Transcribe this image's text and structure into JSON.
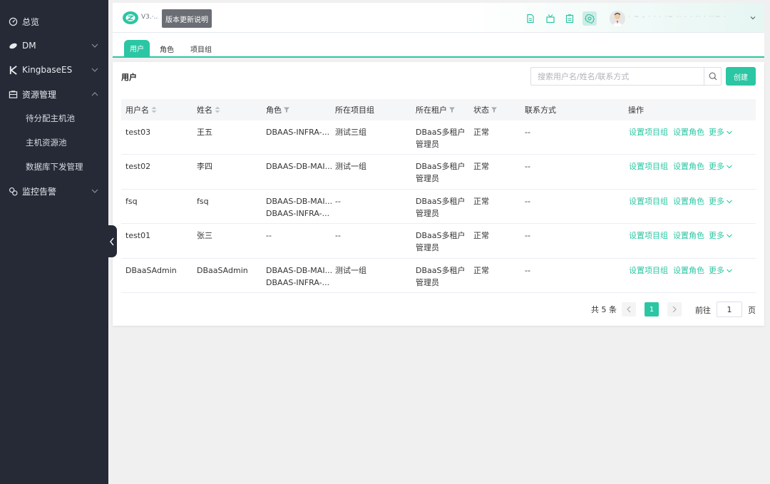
{
  "sidebar": {
    "items": [
      {
        "label": "总览",
        "icon": "dashboard-icon"
      },
      {
        "label": "DM",
        "icon": "dm-icon"
      },
      {
        "label": "KingbaseES",
        "icon": "kingbase-icon"
      },
      {
        "label": "资源管理",
        "icon": "resource-icon"
      },
      {
        "label": "监控告警",
        "icon": "monitor-icon"
      }
    ],
    "sub_items": [
      {
        "label": "待分配主机池"
      },
      {
        "label": "主机资源池"
      },
      {
        "label": "数据库下发管理"
      }
    ]
  },
  "header": {
    "logo_text": "V3.·..",
    "version_button": "版本更新说明",
    "user_name": "· ~ - · ·  · ·~ ·· · ·  ·· ·  ··~ ·",
    "accent": "#2bc6a3"
  },
  "tabs": [
    {
      "label": "用户"
    },
    {
      "label": "角色"
    },
    {
      "label": "项目组"
    }
  ],
  "panel": {
    "title": "用户",
    "search_placeholder": "搜索用户名/姓名/联系方式",
    "create_label": "创建"
  },
  "table": {
    "headers": {
      "username": "用户名",
      "name": "姓名",
      "role": "角色",
      "project": "所在项目组",
      "tenant": "所在租户",
      "status": "状态",
      "contact": "联系方式",
      "actions": "操作"
    },
    "rows": [
      {
        "username": "test03",
        "name": "王五",
        "role1": "DBAAS-INFRA-...",
        "role2": "",
        "project": "测试三组",
        "tenant1": "DBaaS多租户",
        "tenant2": "管理员",
        "status": "正常",
        "contact": "--"
      },
      {
        "username": "test02",
        "name": "李四",
        "role1": "DBAAS-DB-MAI...",
        "role2": "",
        "project": "测试一组",
        "tenant1": "DBaaS多租户",
        "tenant2": "管理员",
        "status": "正常",
        "contact": "--"
      },
      {
        "username": "fsq",
        "name": "fsq",
        "role1": "DBAAS-DB-MAI...",
        "role2": "DBAAS-INFRA-...",
        "project": "--",
        "tenant1": "DBaaS多租户",
        "tenant2": "管理员",
        "status": "正常",
        "contact": "--"
      },
      {
        "username": "test01",
        "name": "张三",
        "role1": "--",
        "role2": "",
        "project": "--",
        "tenant1": "DBaaS多租户",
        "tenant2": "管理员",
        "status": "正常",
        "contact": "--"
      },
      {
        "username": "DBaaSAdmin",
        "name": "DBaaSAdmin",
        "role1": "DBAAS-DB-MAI...",
        "role2": "DBAAS-INFRA-...",
        "project": "测试一组",
        "tenant1": "DBaaS多租户",
        "tenant2": "管理员",
        "status": "正常",
        "contact": "--"
      }
    ],
    "action_labels": {
      "set_project": "设置项目组",
      "set_role": "设置角色",
      "more": "更多"
    }
  },
  "pagination": {
    "total_text": "共 5 条",
    "current_page": "1",
    "goto_label": "前往",
    "goto_value": "1",
    "page_suffix": "页"
  }
}
